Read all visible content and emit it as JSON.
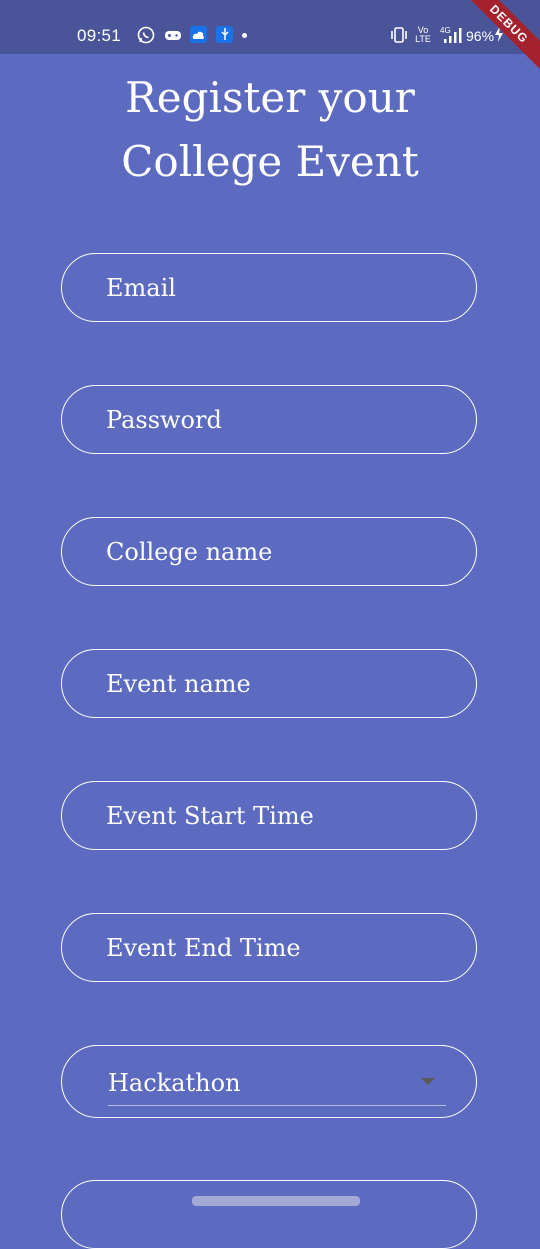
{
  "status_bar": {
    "time": "09:51",
    "battery": "96%",
    "network": "4G",
    "volte": [
      "Vo",
      "LTE"
    ],
    "icons": [
      "whatsapp-icon",
      "game-controller-icon",
      "cloud-app-icon",
      "usb-icon",
      "notification-dot-icon",
      "vibrate-icon",
      "volte-icon",
      "signal-icon",
      "charging-icon"
    ]
  },
  "debug_banner": "DEBUG",
  "page": {
    "title_line1": "Register your",
    "title_line2": "College Event"
  },
  "form": {
    "fields": [
      {
        "label": "Email"
      },
      {
        "label": "Password"
      },
      {
        "label": "College name"
      },
      {
        "label": "Event name"
      },
      {
        "label": "Event Start Time"
      },
      {
        "label": "Event End Time"
      }
    ],
    "event_type": {
      "selected": "Hackathon"
    }
  },
  "colors": {
    "background": "#5c6bc0",
    "status_bar": "#4a5599",
    "debug_banner": "#a3222e",
    "field_border": "#ffffff"
  }
}
